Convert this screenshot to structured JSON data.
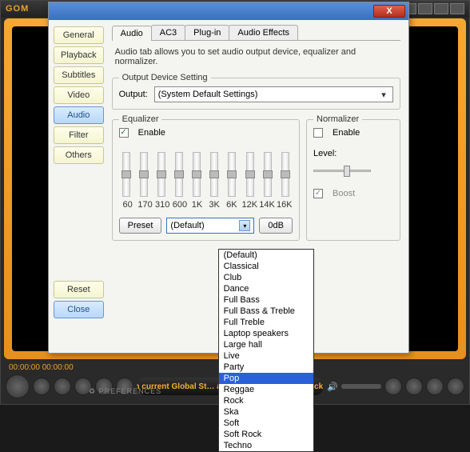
{
  "app": {
    "logo": "GOM"
  },
  "player": {
    "time": "00:00:00   00:00:00",
    "marquee": "Watch current Global St…                    atches on GOMTV.net! Click here!",
    "volume_icon": "🔊"
  },
  "dialog": {
    "close": "X",
    "sidebar": {
      "items": [
        "General",
        "Playback",
        "Subtitles",
        "Video",
        "Audio",
        "Filter",
        "Others"
      ],
      "active_index": 4,
      "reset": "Reset",
      "close": "Close"
    },
    "tabs": {
      "items": [
        "Audio",
        "AC3",
        "Plug-in",
        "Audio Effects"
      ],
      "active_index": 0
    },
    "audio": {
      "description": "Audio tab allows you to set audio output device, equalizer and normalizer.",
      "output_group": "Output Device Setting",
      "output_label": "Output:",
      "output_value": "(System Default Settings)",
      "equalizer": {
        "title": "Equalizer",
        "enable": "Enable",
        "enabled": true,
        "bands": [
          "60",
          "170",
          "310",
          "600",
          "1K",
          "3K",
          "6K",
          "12K",
          "14K",
          "16K"
        ],
        "preset_btn": "Preset",
        "preset_value": "(Default)",
        "zero_btn": "0dB"
      },
      "normalizer": {
        "title": "Normalizer",
        "enable": "Enable",
        "enabled": false,
        "level": "Level:",
        "boost": "Boost",
        "boost_on": true
      },
      "preset_options": [
        "(Default)",
        "Classical",
        "Club",
        "Dance",
        "Full Bass",
        "Full Bass & Treble",
        "Full Treble",
        "Laptop speakers",
        "Large hall",
        "Live",
        "Party",
        "Pop",
        "Reggae",
        "Rock",
        "Ska",
        "Soft",
        "Soft Rock",
        "Techno"
      ],
      "preset_highlight_index": 11
    },
    "footer": "♻ PREFERENCES"
  }
}
